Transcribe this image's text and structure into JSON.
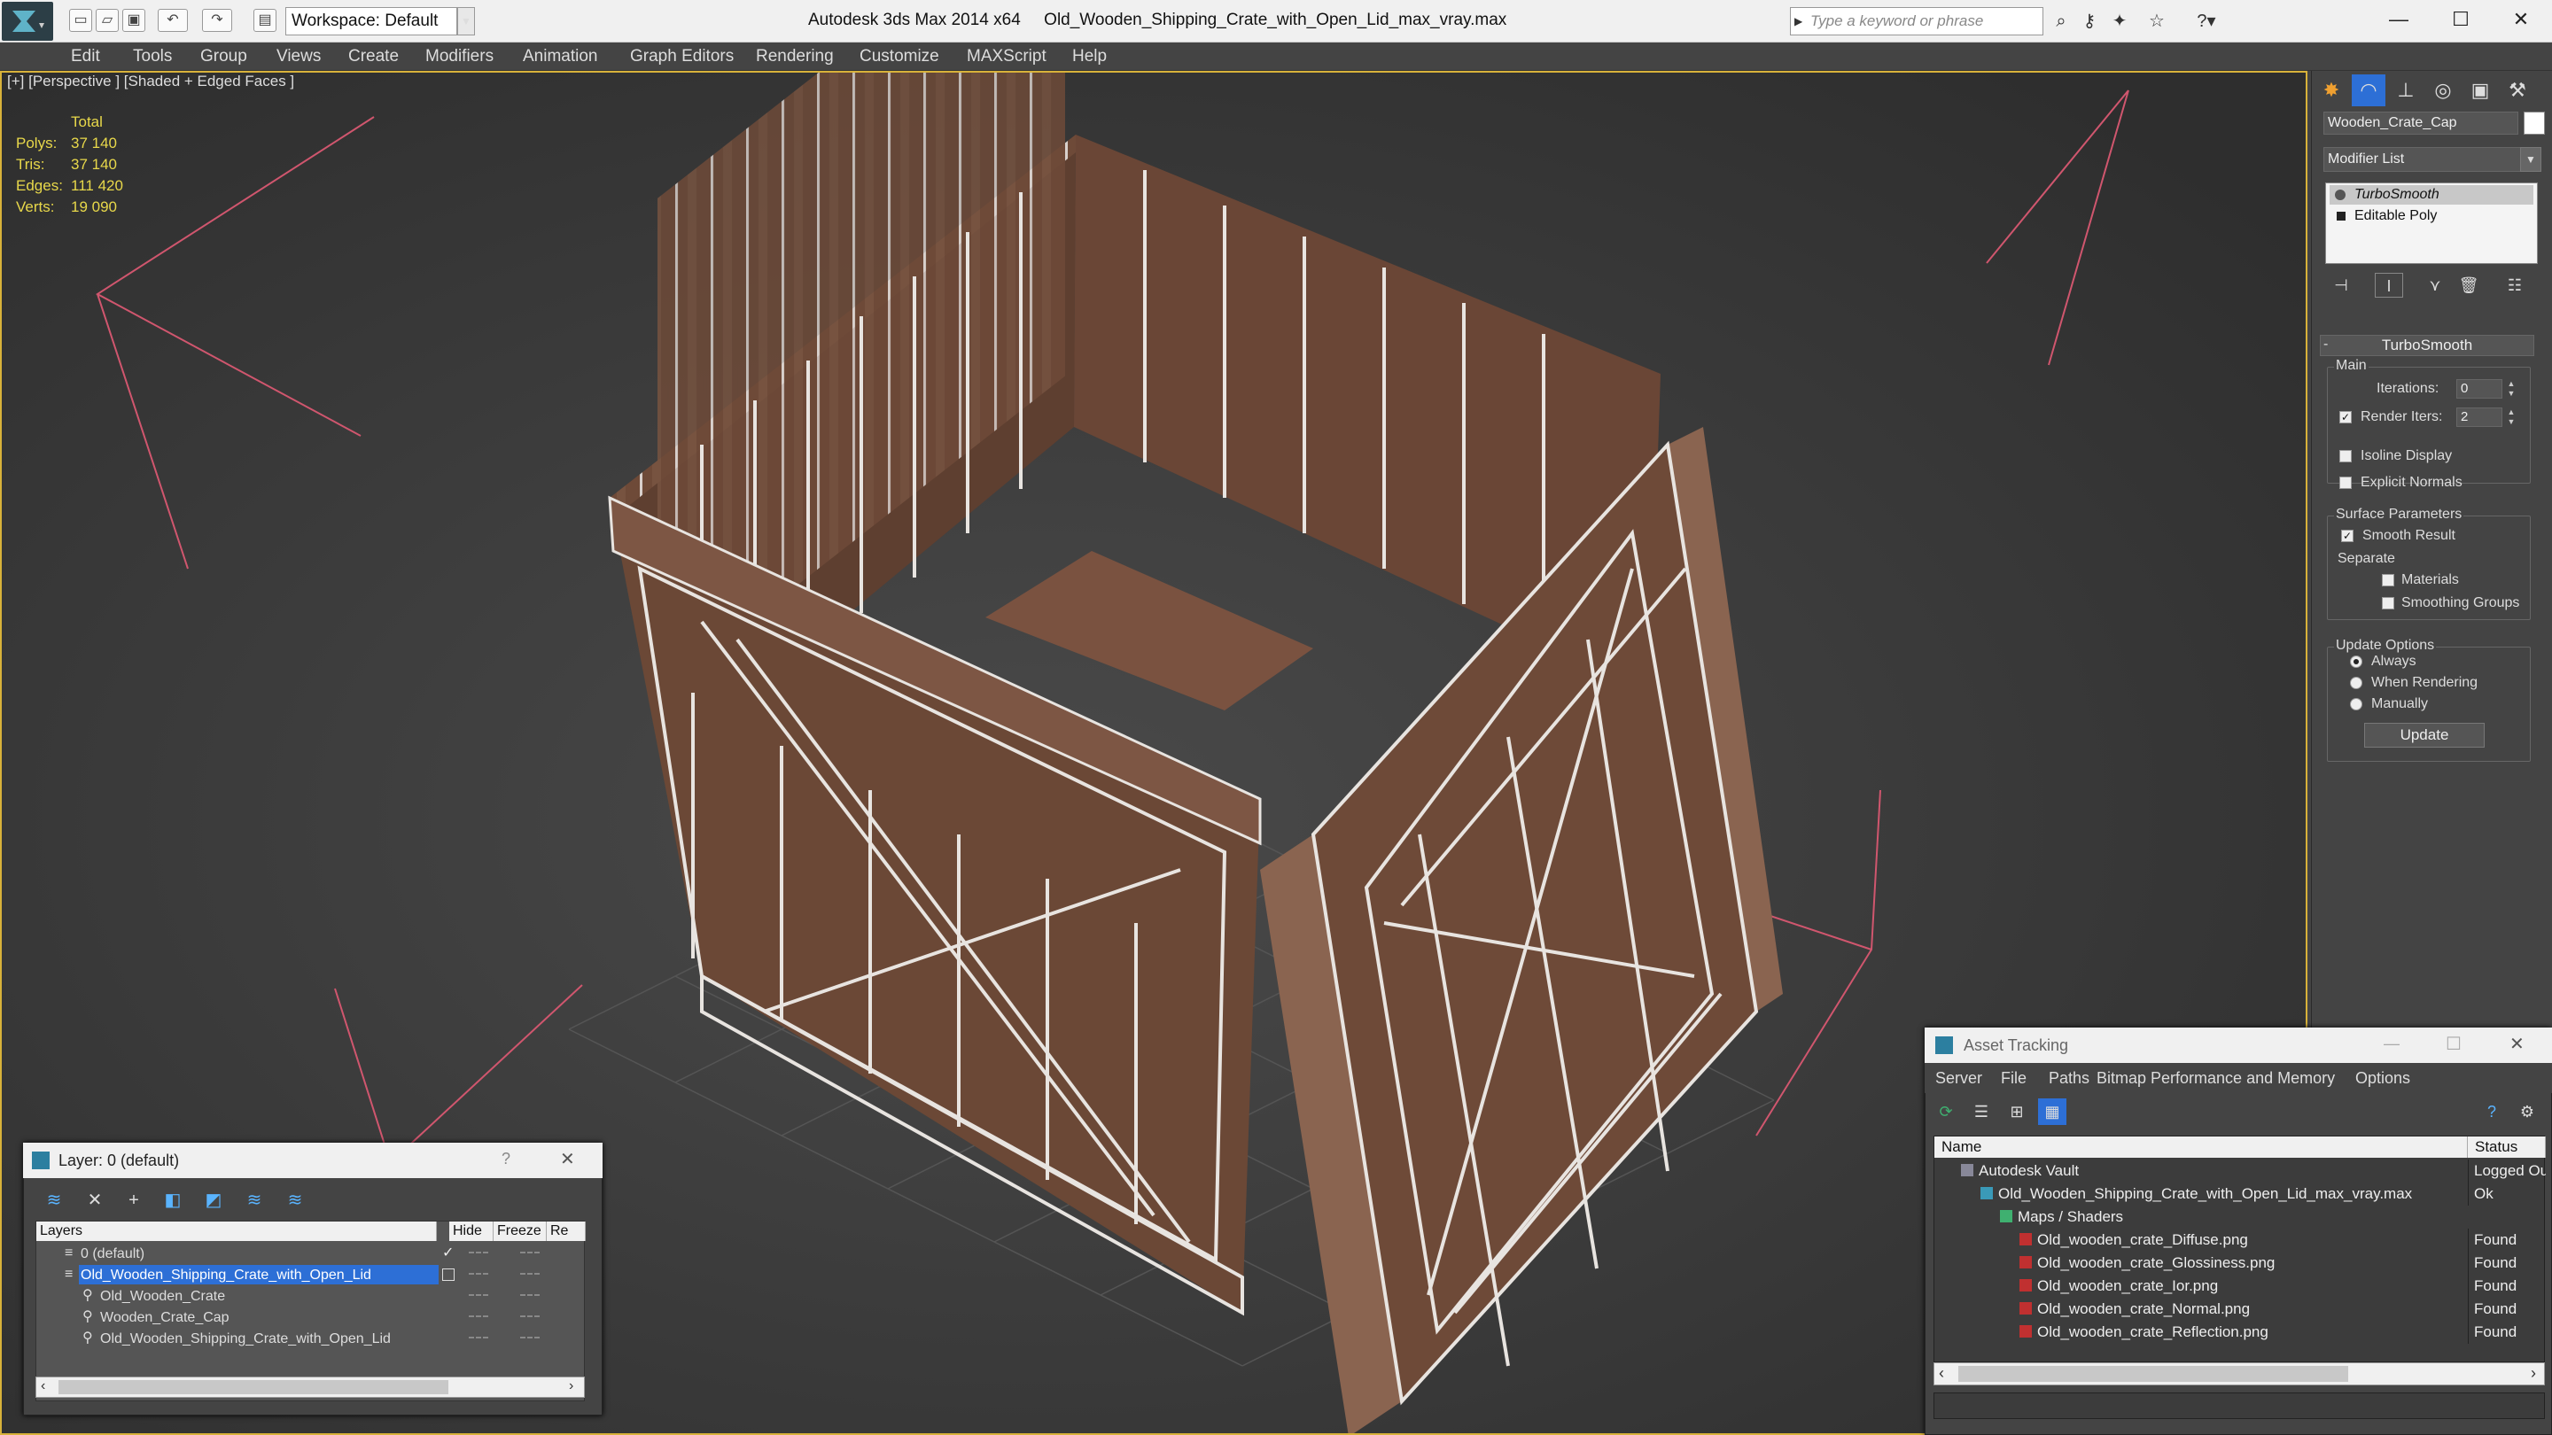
{
  "titlebar": {
    "workspace": "Workspace: Default",
    "app_name": "Autodesk 3ds Max 2014 x64",
    "file_name": "Old_Wooden_Shipping_Crate_with_Open_Lid_max_vray.max",
    "search_placeholder": "Type a keyword or phrase",
    "icons": [
      "new-file-icon",
      "open-file-icon",
      "save-icon",
      "undo-icon",
      "redo-icon",
      "project-folder-icon",
      "binoculars-icon",
      "key-icon",
      "favorites-icon",
      "star-icon",
      "help-icon"
    ]
  },
  "menubar": {
    "items": [
      "Edit",
      "Tools",
      "Group",
      "Views",
      "Create",
      "Modifiers",
      "Animation",
      "Graph Editors",
      "Rendering",
      "Customize",
      "MAXScript",
      "Help"
    ]
  },
  "viewport": {
    "label": "[+] [Perspective ] [Shaded + Edged Faces ]",
    "stats": {
      "header": "Total",
      "rows": [
        {
          "key": "Polys:",
          "value": "37 140"
        },
        {
          "key": "Tris:",
          "value": "37 140"
        },
        {
          "key": "Edges:",
          "value": "111 420"
        },
        {
          "key": "Verts:",
          "value": "19 090"
        }
      ]
    }
  },
  "command_panel": {
    "object_name": "Wooden_Crate_Cap",
    "modifier_list": "Modifier List",
    "stack": [
      "TurboSmooth",
      "Editable Poly"
    ],
    "rollout_title": "TurboSmooth",
    "main_group": "Main",
    "iterations_label": "Iterations:",
    "iterations_value": "0",
    "render_iters_label": "Render Iters:",
    "render_iters_value": "2",
    "render_iters_checked": true,
    "isoline_label": "Isoline Display",
    "explicit_normals_label": "Explicit Normals",
    "surface_group": "Surface Parameters",
    "smooth_result_label": "Smooth Result",
    "separate_label": "Separate",
    "materials_label": "Materials",
    "smoothing_groups_label": "Smoothing Groups",
    "update_group": "Update Options",
    "update_always": "Always",
    "update_when_rendering": "When Rendering",
    "update_manually": "Manually",
    "update_button": "Update"
  },
  "layer_dialog": {
    "title": "Layer: 0 (default)",
    "help": "?",
    "columns": [
      "Layers",
      "Hide",
      "Freeze",
      "Re"
    ],
    "rows": [
      {
        "name": "0 (default)",
        "indent": 0,
        "selected": false,
        "current": true
      },
      {
        "name": "Old_Wooden_Shipping_Crate_with_Open_Lid",
        "indent": 0,
        "selected": true,
        "current": false
      },
      {
        "name": "Old_Wooden_Crate",
        "indent": 1,
        "selected": false,
        "current": false
      },
      {
        "name": "Wooden_Crate_Cap",
        "indent": 1,
        "selected": false,
        "current": false
      },
      {
        "name": "Old_Wooden_Shipping_Crate_with_Open_Lid",
        "indent": 1,
        "selected": false,
        "current": false
      }
    ]
  },
  "asset_tracking": {
    "title": "Asset Tracking",
    "menu": [
      "Server",
      "File",
      "Paths",
      "Bitmap Performance and Memory",
      "Options"
    ],
    "columns": [
      "Name",
      "Status"
    ],
    "rows": [
      {
        "name": "Autodesk Vault",
        "status": "Logged Out",
        "indent": 1
      },
      {
        "name": "Old_Wooden_Shipping_Crate_with_Open_Lid_max_vray.max",
        "status": "Ok",
        "indent": 2
      },
      {
        "name": "Maps / Shaders",
        "status": "",
        "indent": 3
      },
      {
        "name": "Old_wooden_crate_Diffuse.png",
        "status": "Found",
        "indent": 4
      },
      {
        "name": "Old_wooden_crate_Glossiness.png",
        "status": "Found",
        "indent": 4
      },
      {
        "name": "Old_wooden_crate_Ior.png",
        "status": "Found",
        "indent": 4
      },
      {
        "name": "Old_wooden_crate_Normal.png",
        "status": "Found",
        "indent": 4
      },
      {
        "name": "Old_wooden_crate_Reflection.png",
        "status": "Found",
        "indent": 4
      }
    ]
  },
  "colors": {
    "viewport_border": "#d8b23a",
    "selection": "#2d6fd6",
    "stats": "#e8d84a",
    "wood": "#7a5440"
  }
}
